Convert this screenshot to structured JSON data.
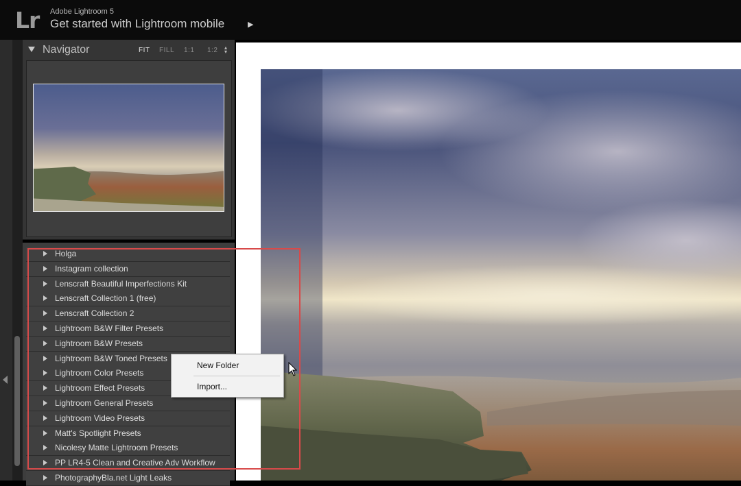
{
  "app": {
    "logo": "Lr",
    "name": "Adobe Lightroom 5",
    "tagline": "Get started with Lightroom mobile",
    "tagline_arrow": "▶"
  },
  "navigator": {
    "title": "Navigator",
    "zoom_options": [
      "FIT",
      "FILL",
      "1:1",
      "1:2"
    ],
    "active_zoom": "FIT"
  },
  "presets": [
    "Holga",
    "Instagram collection",
    "Lenscraft Beautiful Imperfections Kit",
    "Lenscraft Collection 1 (free)",
    "Lenscraft Collection 2",
    "Lightroom B&W Filter Presets",
    "Lightroom B&W Presets",
    "Lightroom B&W Toned Presets",
    "Lightroom Color Presets",
    "Lightroom Effect Presets",
    "Lightroom General Presets",
    "Lightroom Video Presets",
    "Matt's Spotlight Presets",
    "Nicolesy Matte Lightroom Presets",
    "PP LR4-5 Clean and Creative Adv Workflow",
    "PhotographyBla.net Light Leaks"
  ],
  "context_menu": {
    "items": [
      "New Folder",
      "Import..."
    ]
  },
  "colors": {
    "highlight": "#d84a4a",
    "panel_bg": "#353535",
    "top_bar_bg": "#0b0b0b"
  }
}
